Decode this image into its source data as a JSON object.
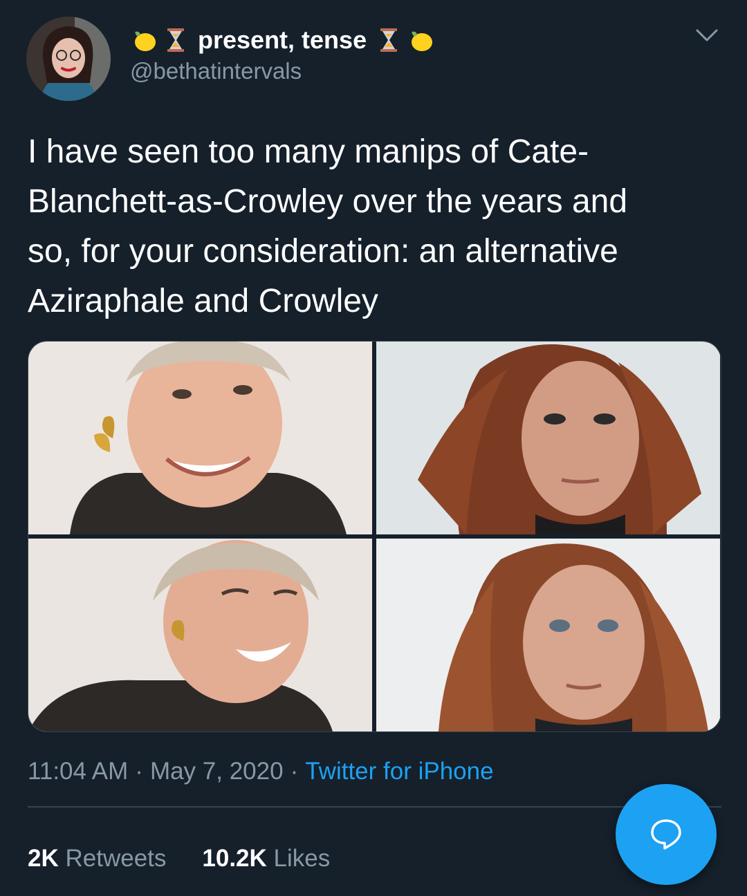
{
  "author": {
    "display_name": "present, tense",
    "handle": "@bethatintervals",
    "name_emojis": [
      "lemon-icon",
      "hourglass-icon",
      "hourglass-icon",
      "lemon-icon"
    ]
  },
  "tweet": {
    "text_lines": [
      "I have seen too many manips of Cate-",
      "Blanchett-as-Crowley over the years and",
      "so, for your consideration: an alternative",
      "Aziraphale and Crowley"
    ],
    "time": "11:04 AM",
    "date": "May 7, 2020",
    "source": "Twitter for iPhone",
    "separator": "·"
  },
  "stats": {
    "retweets_count": "2K",
    "retweets_label": "Retweets",
    "likes_count": "10.2K",
    "likes_label": "Likes"
  },
  "colors": {
    "background": "#15202b",
    "secondary_text": "#8899a6",
    "accent": "#1da1f2",
    "border": "#38444d"
  },
  "icons": {
    "more_menu": "chevron-down-icon",
    "compose": "reply-bubble-icon"
  }
}
